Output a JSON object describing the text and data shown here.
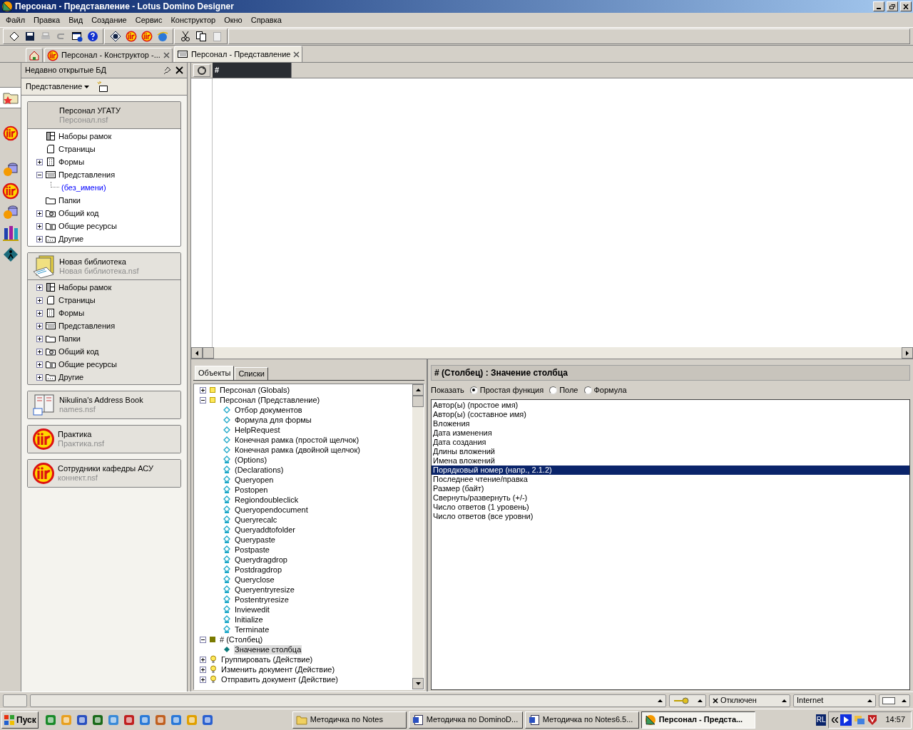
{
  "window": {
    "title": "Персонал - Представление - Lotus Domino Designer"
  },
  "menu": [
    "Файл",
    "Правка",
    "Вид",
    "Создание",
    "Сервис",
    "Конструктор",
    "Окно",
    "Справка"
  ],
  "tabs": [
    {
      "kind": "home",
      "selected": false
    },
    {
      "kind": "notes",
      "label": "Персонал - Конструктор -...",
      "selected": false
    },
    {
      "kind": "view",
      "label": "Персонал - Представление",
      "selected": true
    }
  ],
  "recent_panel": {
    "title": "Недавно открытые БД",
    "view_menu": "Представление"
  },
  "databases": [
    {
      "title": "Персонал УГАТУ",
      "file": "Персонал.nsf",
      "kind": "plain",
      "selected": true,
      "items": [
        {
          "label": "Наборы рамок",
          "kind": "frameset"
        },
        {
          "label": "Страницы",
          "kind": "page"
        },
        {
          "label": "Формы",
          "kind": "form",
          "expanded": false
        },
        {
          "label": "Представления",
          "kind": "view",
          "expanded": true,
          "children": [
            {
              "label": "(без_имени)",
              "kind": "link"
            }
          ]
        },
        {
          "label": "Папки",
          "kind": "folder"
        },
        {
          "label": "Общий код",
          "kind": "code",
          "expanded": false
        },
        {
          "label": "Общие ресурсы",
          "kind": "resources",
          "expanded": false
        },
        {
          "label": "Другие",
          "kind": "other",
          "expanded": false
        }
      ]
    },
    {
      "title": "Новая библиотека",
      "file": "Новая библиотека.nsf",
      "kind": "library",
      "selected": false,
      "items": [
        {
          "label": "Наборы рамок",
          "kind": "frameset",
          "expanded": false
        },
        {
          "label": "Страницы",
          "kind": "page",
          "expanded": false
        },
        {
          "label": "Формы",
          "kind": "form",
          "expanded": false
        },
        {
          "label": "Представления",
          "kind": "view",
          "expanded": false
        },
        {
          "label": "Папки",
          "kind": "folder",
          "expanded": false
        },
        {
          "label": "Общий код",
          "kind": "code",
          "expanded": false
        },
        {
          "label": "Общие ресурсы",
          "kind": "resources",
          "expanded": false
        },
        {
          "label": "Другие",
          "kind": "other",
          "expanded": false
        }
      ]
    },
    {
      "title": "Nikulina's Address Book",
      "file": "names.nsf",
      "kind": "addressbook",
      "selected": false
    },
    {
      "title": "Практика",
      "file": "Практика.nsf",
      "kind": "notes",
      "selected": false
    },
    {
      "title": "Сотрудники кафедры АСУ",
      "file": "коннект.nsf",
      "kind": "notes",
      "selected": false
    }
  ],
  "view": {
    "column_header": "#"
  },
  "object_tabs": [
    {
      "label": "Объекты",
      "selected": true
    },
    {
      "label": "Списки",
      "selected": false
    }
  ],
  "objects": [
    {
      "label": "Персонал (Globals)",
      "kind": "globals",
      "expanded": false,
      "selected": false
    },
    {
      "label": "Персонал (Представление)",
      "kind": "globals",
      "expanded": true,
      "selected": false,
      "children": [
        {
          "label": "Отбор документов",
          "kind": "formula",
          "selected": false
        },
        {
          "label": "Формула для формы",
          "kind": "formula",
          "selected": false
        },
        {
          "label": "HelpRequest",
          "kind": "formula",
          "selected": false
        },
        {
          "label": "Конечная рамка (простой щелчок)",
          "kind": "formula",
          "selected": false
        },
        {
          "label": "Конечная рамка (двойной щелчок)",
          "kind": "formula",
          "selected": false
        },
        {
          "label": "(Options)",
          "kind": "script",
          "selected": false
        },
        {
          "label": "(Declarations)",
          "kind": "script",
          "selected": false
        },
        {
          "label": "Queryopen",
          "kind": "script",
          "selected": false
        },
        {
          "label": "Postopen",
          "kind": "script",
          "selected": false
        },
        {
          "label": "Regiondoubleclick",
          "kind": "script",
          "selected": false
        },
        {
          "label": "Queryopendocument",
          "kind": "script",
          "selected": false
        },
        {
          "label": "Queryrecalc",
          "kind": "script",
          "selected": false
        },
        {
          "label": "Queryaddtofolder",
          "kind": "script",
          "selected": false
        },
        {
          "label": "Querypaste",
          "kind": "script",
          "selected": false
        },
        {
          "label": "Postpaste",
          "kind": "script",
          "selected": false
        },
        {
          "label": "Querydragdrop",
          "kind": "script",
          "selected": false
        },
        {
          "label": "Postdragdrop",
          "kind": "script",
          "selected": false
        },
        {
          "label": "Queryclose",
          "kind": "script",
          "selected": false
        },
        {
          "label": "Queryentryresize",
          "kind": "script",
          "selected": false
        },
        {
          "label": "Postentryresize",
          "kind": "script",
          "selected": false
        },
        {
          "label": "Inviewedit",
          "kind": "script",
          "selected": false
        },
        {
          "label": "Initialize",
          "kind": "script",
          "selected": false
        },
        {
          "label": "Terminate",
          "kind": "script",
          "selected": false
        }
      ]
    },
    {
      "label": "# (Столбец)",
      "kind": "column",
      "expanded": true,
      "selected": false,
      "children": [
        {
          "label": "Значение столбца",
          "kind": "value",
          "selected": true
        }
      ]
    },
    {
      "label": "Группировать (Действие)",
      "kind": "action",
      "expanded": false,
      "selected": false
    },
    {
      "label": "Изменить документ (Действие)",
      "kind": "action",
      "expanded": false,
      "selected": false
    },
    {
      "label": "Отправить документ (Действие)",
      "kind": "action",
      "expanded": false,
      "selected": false
    }
  ],
  "properties": {
    "title": "# (Столбец) : Значение столбца",
    "show_label": "Показать",
    "options": [
      {
        "label": "Простая функция",
        "selected": true
      },
      {
        "label": "Поле",
        "selected": false
      },
      {
        "label": "Формула",
        "selected": false
      }
    ],
    "functions": [
      {
        "label": "Автор(ы) (простое имя)",
        "selected": false
      },
      {
        "label": "Автор(ы) (составное имя)",
        "selected": false
      },
      {
        "label": "Вложения",
        "selected": false
      },
      {
        "label": "Дата изменения",
        "selected": false
      },
      {
        "label": "Дата создания",
        "selected": false
      },
      {
        "label": "Длины вложений",
        "selected": false
      },
      {
        "label": "Имена вложений",
        "selected": false
      },
      {
        "label": "Порядковый номер (напр., 2.1.2)",
        "selected": true
      },
      {
        "label": "Последнее чтение/правка",
        "selected": false
      },
      {
        "label": "Размер (байт)",
        "selected": false
      },
      {
        "label": "Свернуть/развернуть (+/-)",
        "selected": false
      },
      {
        "label": "Число ответов (1 уровень)",
        "selected": false
      },
      {
        "label": "Число ответов (все уровни)",
        "selected": false
      }
    ]
  },
  "status_bar": {
    "connection": "Отключен",
    "location": "Internet"
  },
  "taskbar": {
    "start": "Пуск",
    "buttons": [
      {
        "label": "Методичка по Notes",
        "kind": "folder",
        "selected": false
      },
      {
        "label": "Методичка по DominoD...",
        "kind": "word",
        "selected": false
      },
      {
        "label": "Методичка по Notes6.5...",
        "kind": "word",
        "selected": false
      },
      {
        "label": "Персонал - Предста...",
        "kind": "designer",
        "selected": true
      }
    ],
    "language": "RL",
    "clock": "14:57"
  }
}
